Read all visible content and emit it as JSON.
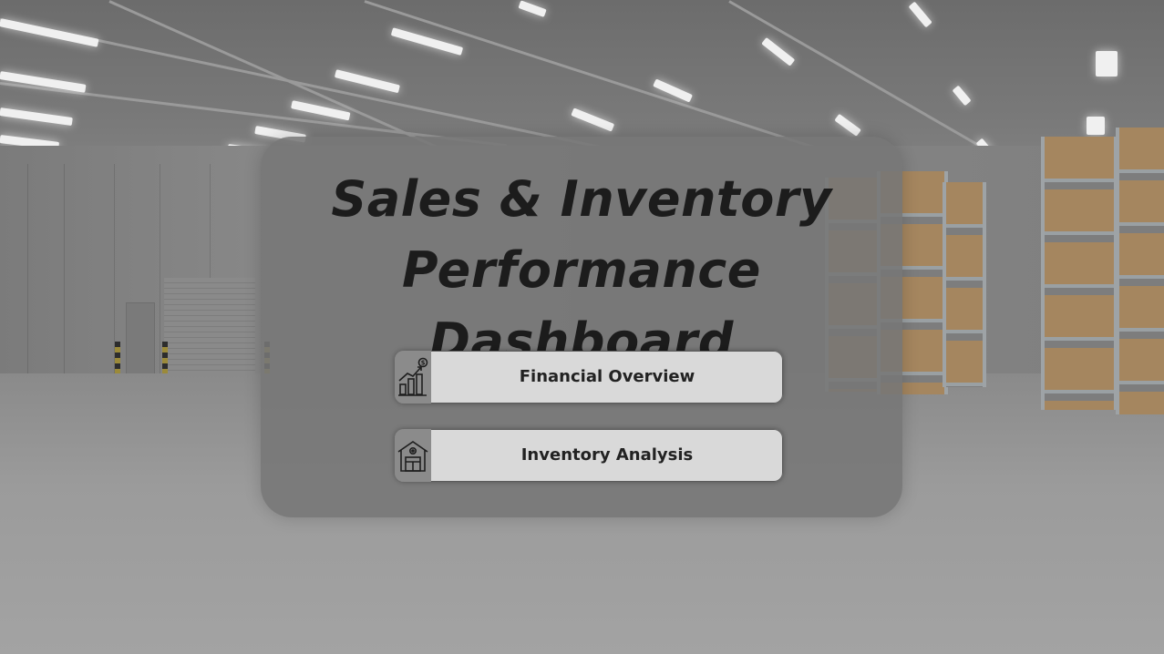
{
  "dashboard": {
    "title_line1": "Sales & Inventory",
    "title_line2": "Performance Dashboard"
  },
  "nav": {
    "items": [
      {
        "label": "Financial Overview",
        "icon": "financial-growth-icon"
      },
      {
        "label": "Inventory Analysis",
        "icon": "warehouse-icon"
      }
    ]
  },
  "colors": {
    "card_bg": "#767676",
    "button_bg": "#d9d9d9",
    "icon_box_bg": "#8b8b8b",
    "title_text": "#1c1c1c",
    "button_text": "#222222"
  }
}
